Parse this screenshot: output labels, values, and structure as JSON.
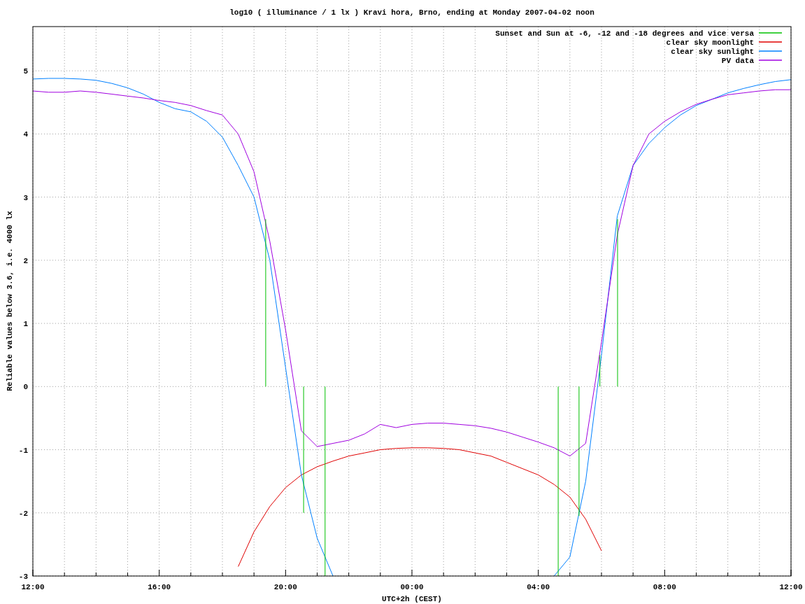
{
  "chart_data": {
    "type": "line",
    "title": "log10 ( illuminance / 1 lx ) Kravi hora, Brno, ending at Monday 2007-04-02 noon",
    "xlabel": "UTC+2h (CEST)",
    "ylabel": "Reliable values below 3.6, i.e. 4000 lx",
    "categories": [
      "12:00",
      null,
      null,
      null,
      null,
      null,
      null,
      null,
      "16:00",
      null,
      null,
      null,
      null,
      null,
      null,
      null,
      "20:00",
      null,
      null,
      null,
      null,
      null,
      null,
      null,
      "00:00",
      null,
      null,
      null,
      null,
      null,
      null,
      null,
      "04:00",
      null,
      null,
      null,
      null,
      null,
      null,
      null,
      "08:00",
      null,
      null,
      null,
      null,
      null,
      null,
      null,
      "12:00"
    ],
    "series": [
      {
        "name": "Sunset and Sun at -6, -12 and -18 degrees and vice versa",
        "color": "#00c000",
        "values": [
          null,
          null,
          null,
          null,
          null,
          null,
          null,
          null,
          null,
          null,
          null,
          null,
          null,
          null,
          null,
          null,
          null,
          null,
          null,
          null,
          null,
          null,
          null,
          null,
          null,
          null,
          null,
          null,
          null,
          null,
          null,
          null,
          null,
          null,
          null,
          null,
          null,
          null,
          null,
          null,
          null,
          null,
          null,
          null,
          null,
          null,
          null,
          null,
          null
        ]
      },
      {
        "name": "clear sky moonlight",
        "color": "#e00000",
        "values": [
          null,
          null,
          null,
          null,
          null,
          null,
          null,
          null,
          null,
          null,
          null,
          null,
          null,
          -2.85,
          -2.3,
          -1.9,
          -1.6,
          -1.4,
          -1.27,
          -1.18,
          -1.1,
          -1.05,
          -1.0,
          -0.98,
          -0.97,
          -0.97,
          -0.98,
          -1.0,
          -1.05,
          -1.1,
          -1.2,
          -1.3,
          -1.4,
          -1.55,
          -1.75,
          -2.1,
          -2.6,
          null,
          null,
          null,
          null,
          null,
          null,
          null,
          null,
          null,
          null,
          null,
          null
        ]
      },
      {
        "name": "clear sky sunlight",
        "color": "#0080ff",
        "values": [
          4.87,
          4.88,
          4.88,
          4.87,
          4.85,
          4.8,
          4.73,
          4.63,
          4.5,
          4.4,
          4.35,
          4.2,
          3.95,
          3.5,
          3.0,
          2.0,
          0.3,
          -1.4,
          -2.4,
          -3.0,
          null,
          null,
          null,
          null,
          null,
          null,
          null,
          null,
          null,
          null,
          null,
          null,
          null,
          -3.0,
          -2.7,
          -1.5,
          0.5,
          2.7,
          3.5,
          3.85,
          4.1,
          4.3,
          4.45,
          4.55,
          4.65,
          4.72,
          4.78,
          4.83,
          4.86
        ]
      },
      {
        "name": "PV data",
        "color": "#a000e0",
        "values": [
          4.68,
          4.66,
          4.66,
          4.68,
          4.66,
          4.63,
          4.6,
          4.57,
          4.53,
          4.5,
          4.45,
          4.37,
          4.3,
          4.0,
          3.4,
          2.3,
          0.9,
          -0.7,
          -0.95,
          -0.9,
          -0.85,
          -0.75,
          -0.6,
          -0.65,
          -0.6,
          -0.58,
          -0.58,
          -0.6,
          -0.62,
          -0.66,
          -0.72,
          -0.8,
          -0.88,
          -0.97,
          -1.1,
          -0.9,
          0.7,
          2.4,
          3.5,
          4.0,
          4.2,
          4.35,
          4.47,
          4.55,
          4.62,
          4.65,
          4.68,
          4.7,
          4.7
        ]
      }
    ],
    "ylim": [
      -3,
      5.7
    ],
    "yticks": [
      -3,
      -2,
      -1,
      0,
      1,
      2,
      3,
      4,
      5
    ],
    "grid": true,
    "legend": true
  }
}
